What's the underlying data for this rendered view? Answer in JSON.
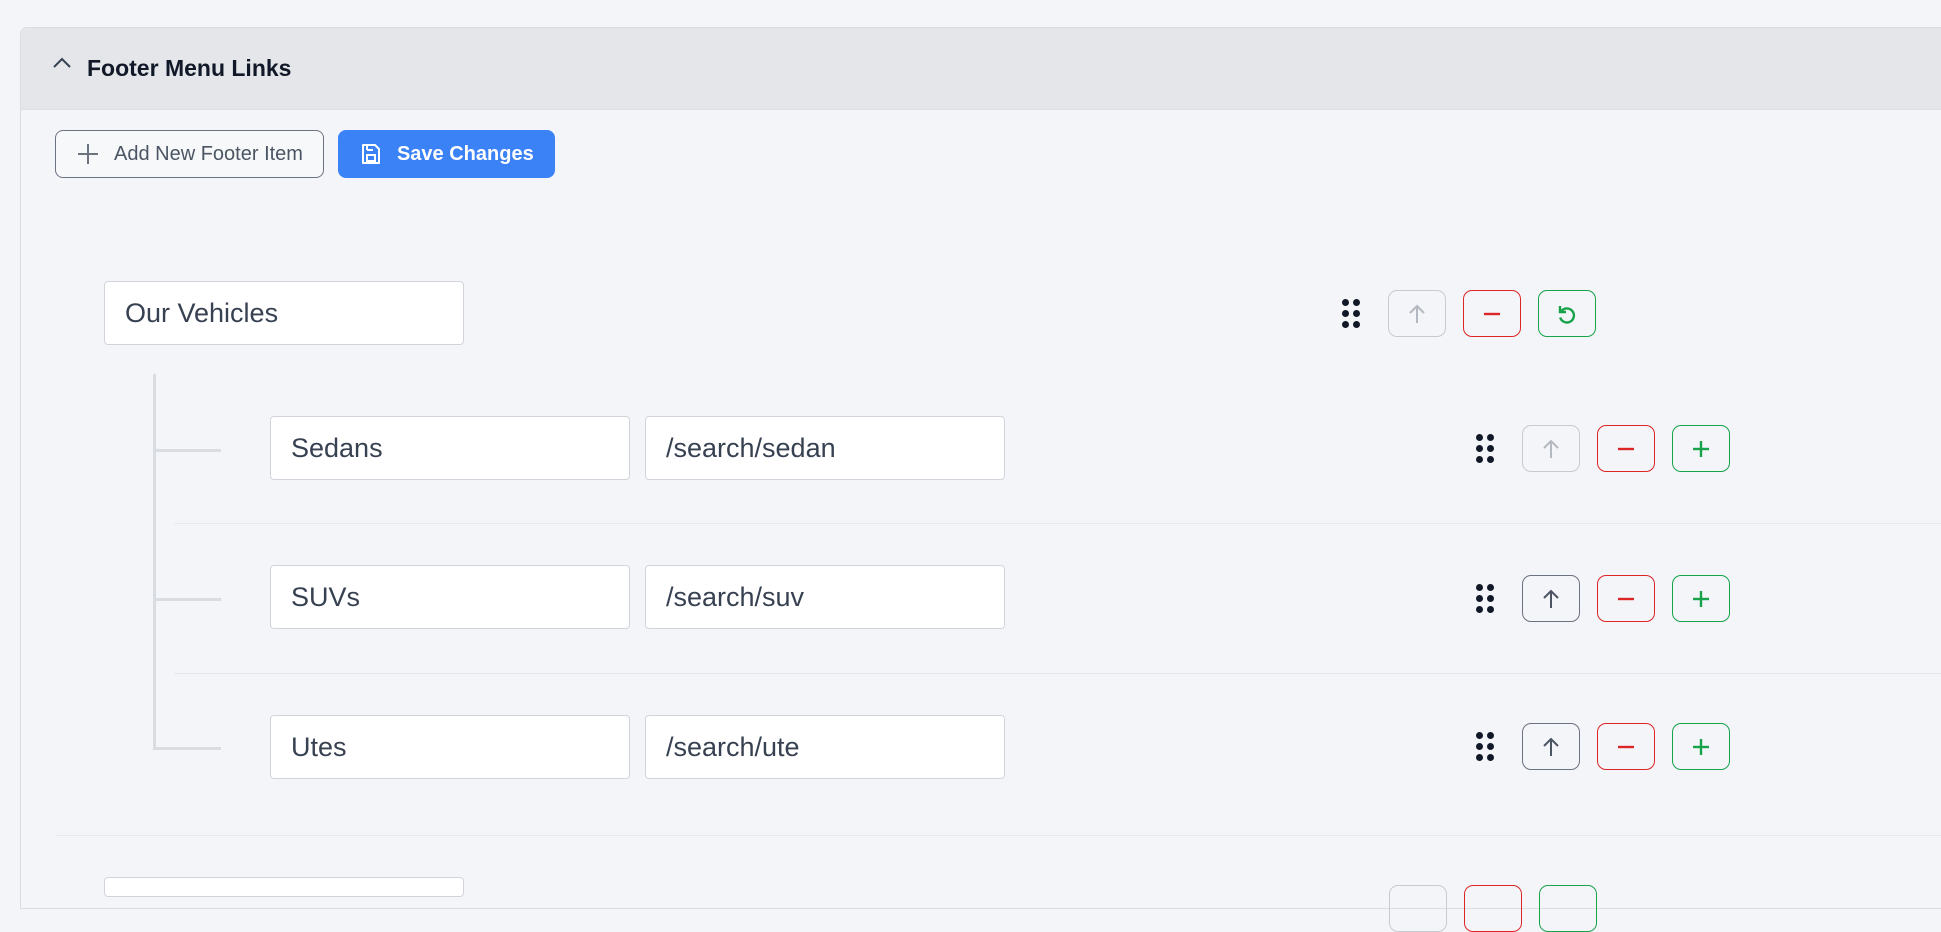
{
  "section": {
    "title": "Footer Menu Links",
    "toolbar": {
      "add_label": "Add New Footer Item",
      "save_label": "Save Changes"
    }
  },
  "groups": [
    {
      "label": "Our Vehicles",
      "children": [
        {
          "label": "Sedans",
          "link": "/search/sedan",
          "up_disabled": true
        },
        {
          "label": "SUVs",
          "link": "/search/suv",
          "up_disabled": false
        },
        {
          "label": "Utes",
          "link": "/search/ute",
          "up_disabled": false
        }
      ]
    }
  ],
  "colors": {
    "primary": "#3b82f6",
    "danger": "#dc2626",
    "success": "#16a34a",
    "header_bg": "#e4e6ea"
  },
  "icons": {
    "collapse": "chevron-up-icon",
    "add": "plus-icon",
    "save": "save-icon",
    "drag": "drag-handle-icon",
    "move_up": "arrow-up-icon",
    "remove": "minus-icon",
    "restore": "undo-icon"
  }
}
